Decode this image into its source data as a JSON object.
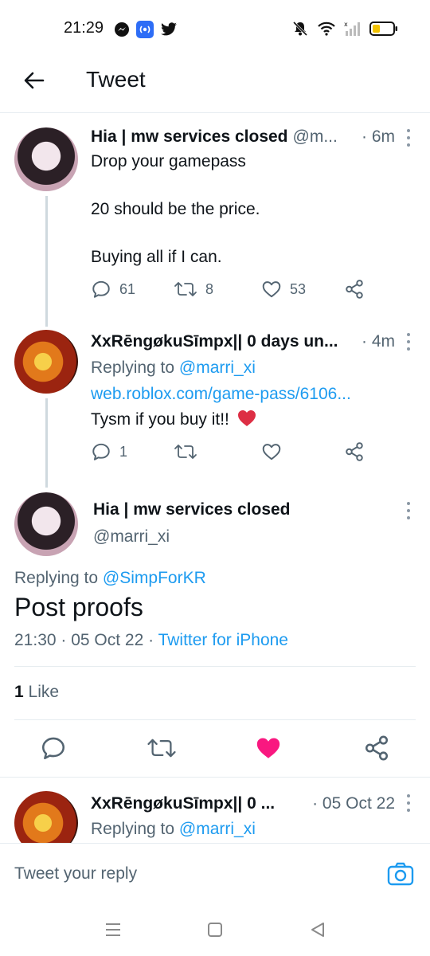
{
  "status_bar": {
    "time": "21:29"
  },
  "header": {
    "title": "Tweet"
  },
  "thread": [
    {
      "name": "Hia | mw services closed",
      "handle": "@m...",
      "time": "· 6m",
      "lines": [
        "Drop your gamepass",
        "20 should be the price.",
        "Buying all if I can."
      ],
      "replies": "61",
      "retweets": "8",
      "likes": "53"
    },
    {
      "name": "XxRēngøkuSīmpx|| 0 days un...",
      "time": "· 4m",
      "replying_label": "Replying to",
      "replying_to": "@marri_xi",
      "link": "web.roblox.com/game-pass/6106...",
      "text": "Tysm if you buy it!!",
      "replies": "1"
    }
  ],
  "main_tweet": {
    "name": "Hia | mw services closed",
    "handle": "@marri_xi",
    "replying_label": "Replying to",
    "replying_to": "@SimpForKR",
    "text": "Post proofs",
    "time_date": "21:30 · 05 Oct 22 ·",
    "source": "Twitter for iPhone",
    "like_count": "1",
    "like_label": "Like"
  },
  "bottom_reply": {
    "name": "XxRēngøkuSīmpx|| 0 ...",
    "time": "· 05 Oct 22",
    "replying_label": "Replying to",
    "replying_to": "@marri_xi"
  },
  "compose": {
    "placeholder": "Tweet your reply"
  },
  "colors": {
    "accent": "#1d9bf0",
    "like_active": "#f91880",
    "heart_emoji": "#dd2e44",
    "text_secondary": "#536471"
  },
  "icons": {
    "status_left": [
      "messenger-icon",
      "radio-app-icon",
      "twitter-bird-icon"
    ],
    "status_right": [
      "mute-bell-icon",
      "wifi-icon",
      "signal-icon",
      "battery-low-icon"
    ],
    "actions": [
      "reply-icon",
      "retweet-icon",
      "like-icon",
      "share-icon"
    ],
    "nav": [
      "menu-icon",
      "home-square-icon",
      "back-triangle-icon"
    ]
  }
}
